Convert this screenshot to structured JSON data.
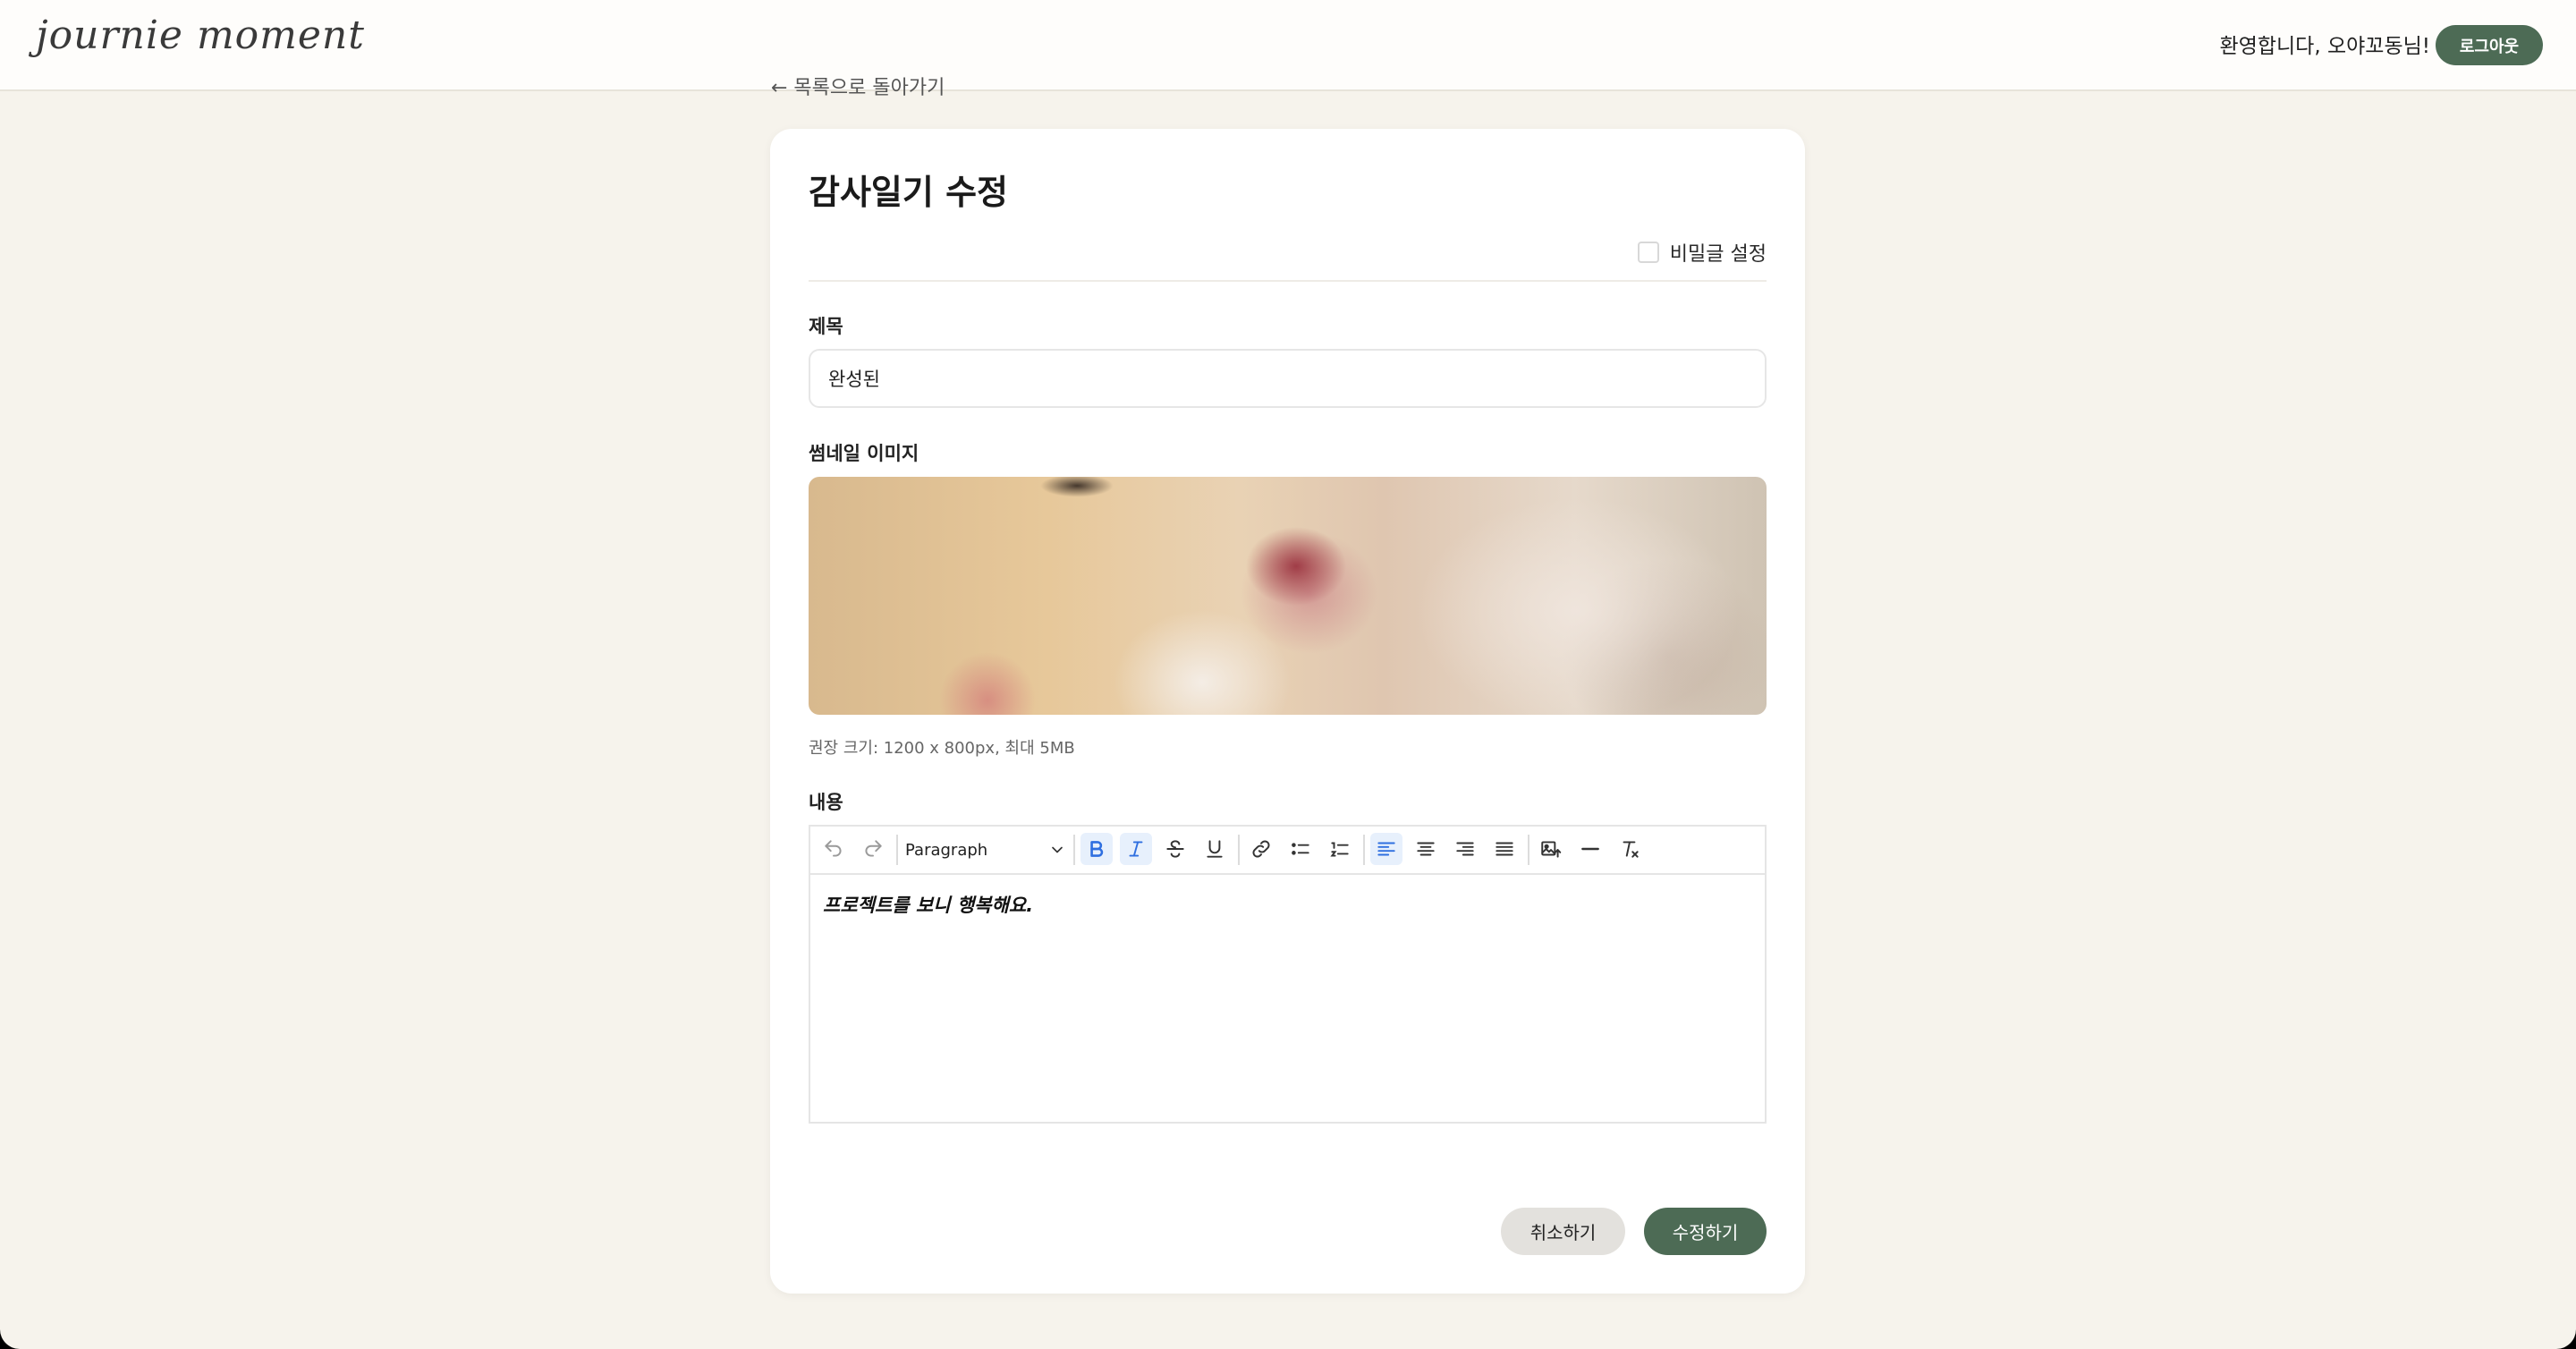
{
  "header": {
    "logo": "journie moment",
    "welcome": "환영합니다, 오야꼬동님!",
    "logout_label": "로그아웃"
  },
  "back_link": "← 목록으로 돌아가기",
  "form": {
    "page_title": "감사일기 수정",
    "secret_label": "비밀글 설정",
    "secret_checked": false,
    "title_label": "제목",
    "title_value": "완성된",
    "thumbnail_label": "썸네일 이미지",
    "thumbnail_hint": "권장 크기: 1200 x 800px, 최대 5MB",
    "content_label": "내용",
    "editor": {
      "block_format": "Paragraph",
      "content": "프로젝트를 보니 행복해요.",
      "toolbar_icons": [
        "undo-icon",
        "redo-icon",
        "bold-icon",
        "italic-icon",
        "strikethrough-icon",
        "underline-icon",
        "link-icon",
        "bullet-list-icon",
        "numbered-list-icon",
        "align-left-icon",
        "align-center-icon",
        "align-right-icon",
        "align-justify-icon",
        "image-upload-icon",
        "horizontal-rule-icon",
        "clear-format-icon"
      ]
    },
    "cancel_label": "취소하기",
    "submit_label": "수정하기"
  },
  "colors": {
    "accent": "#4d6b55",
    "background": "#f6f3ec",
    "toolbar_active": "#2f6fe0"
  }
}
